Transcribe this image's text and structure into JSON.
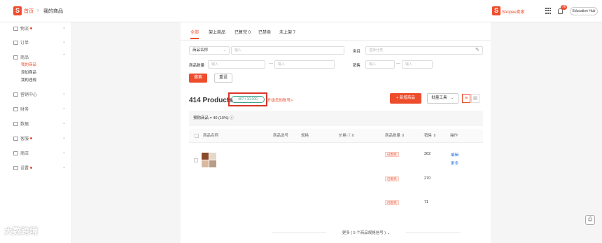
{
  "header": {
    "logo_glyph": "S",
    "breadcrumb_home": "首页",
    "breadcrumb_sep": "›",
    "breadcrumb_page": "我的商品",
    "seller_logo_glyph": "S",
    "seller_center": "Shopee卖家",
    "notification_count": "76",
    "education_hub": "Education Hub"
  },
  "sidebar": {
    "items": [
      {
        "label": "物流",
        "dot": true
      },
      {
        "label": "订单",
        "dot": false
      },
      {
        "label": "商品",
        "dot": false
      },
      {
        "label": "营销中心",
        "dot": false
      },
      {
        "label": "财务",
        "dot": false
      },
      {
        "label": "数据",
        "dot": false
      },
      {
        "label": "客服",
        "dot": true
      },
      {
        "label": "商店",
        "dot": false
      },
      {
        "label": "设置",
        "dot": true
      }
    ],
    "sub_items": [
      "我的商品",
      "添加商品",
      "我的违规"
    ]
  },
  "tabs": [
    "全部",
    "架上商品",
    "已售完 0",
    "已禁卖",
    "未上架 7"
  ],
  "filters": {
    "name_select": "商品名称",
    "name_placeholder": "输入",
    "category_label": "类目",
    "category_placeholder": "选择分类",
    "qty_label": "商品数量",
    "qty_min": "输入",
    "qty_max": "输入",
    "sales_label": "销售",
    "sales_min": "输入",
    "sales_max": "输入",
    "dash": "—",
    "search_button": "搜索",
    "reset_button": "重设"
  },
  "summary": {
    "products_count": "414 Products",
    "quota": "407 / 10,000",
    "upgrade_link": "升级您的账号>",
    "add_button": "+ 新增商品",
    "batch_button": "批量工具",
    "promo": "预购商品 = 40 (10%) ⓘ"
  },
  "table": {
    "headers": [
      "商品名称",
      "商品选号",
      "规格",
      "价格 ⓘ⇕",
      "商品数量 ⇕",
      "销售 ⇕",
      "操作"
    ],
    "status_tag": "已售完",
    "stock_rows": [
      "362",
      "270",
      "71"
    ],
    "actions": [
      "编辑",
      "更多"
    ]
  },
  "more": "更多 ( 5 个商品规格信号 ) ⌄",
  "watermark": "大数跨境",
  "colors": {
    "brand": "#ee4d2d",
    "link": "#2673dd",
    "quota": "#3aa18a",
    "highlight": "#d9342a"
  }
}
